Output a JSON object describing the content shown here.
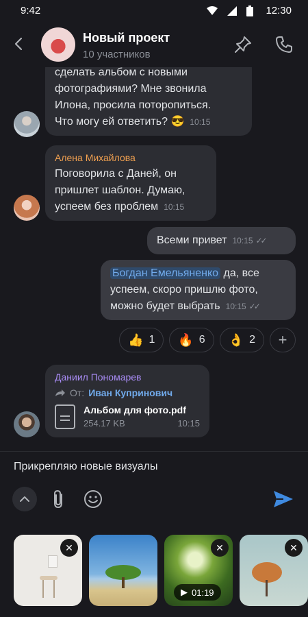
{
  "status": {
    "time_left": "9:42",
    "time_right": "12:30"
  },
  "header": {
    "title": "Новый проект",
    "subtitle": "10 участников"
  },
  "messages": [
    {
      "kind": "in",
      "text": "сделать альбом с новыми\nфотографиями? Мне звонила\nИлона, просила поторопиться.\nЧто могу ей ответить? 😎",
      "time": "10:15"
    },
    {
      "kind": "in",
      "sender": "Алена Михайлова",
      "text": "Поговорила с Даней, он\nпришлет шаблон. Думаю,\nуспеем без проблем",
      "time": "10:15"
    },
    {
      "kind": "out",
      "text": "Всеми привет",
      "time": "10:15"
    },
    {
      "kind": "out",
      "mention": "Богдан Емельяненко",
      "text_after_mention": " да, все\nуспеем, скоро пришлю фото,\nможно будет выбрать",
      "time": "10:15"
    },
    {
      "kind": "in",
      "sender": "Даниил Пономарев",
      "fwd_label": "От:",
      "fwd_name": "Иван Купринович",
      "file_name": "Альбом для фото.pdf",
      "file_size": "254.17 KB",
      "time": "10:15"
    }
  ],
  "reactions": [
    {
      "emoji": "👍",
      "count": "1"
    },
    {
      "emoji": "🔥",
      "count": "6"
    },
    {
      "emoji": "👌",
      "count": "2"
    }
  ],
  "compose": {
    "text": "Прикрепляю новые визуалы"
  },
  "attachments": [
    {
      "type": "image",
      "scene": "white-room"
    },
    {
      "type": "image",
      "scene": "tree-beach"
    },
    {
      "type": "video",
      "scene": "forest",
      "duration": "01:19"
    },
    {
      "type": "image",
      "scene": "autumn-tree"
    }
  ],
  "colors": {
    "background": "#19191e",
    "bubble_in": "#2c2d33",
    "bubble_out": "#3a3b42",
    "accent": "#71aaeb",
    "send": "#3f8ae0"
  }
}
